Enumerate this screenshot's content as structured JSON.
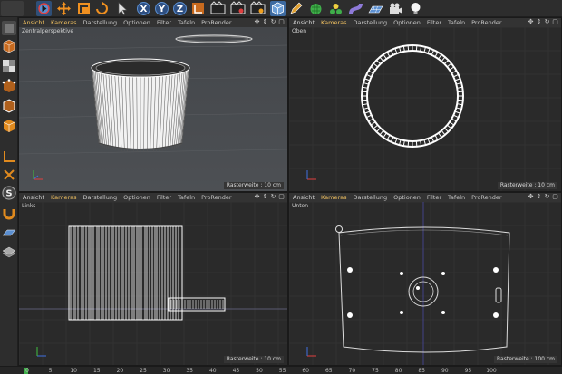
{
  "viewports": {
    "perspective": {
      "menus": [
        "Ansicht",
        "Kameras",
        "Darstellung",
        "Optionen",
        "Filter",
        "Tafeln",
        "ProRender"
      ],
      "label": "Zentralperspektive",
      "raster": "Rasterweite : 10 cm"
    },
    "top": {
      "menus": [
        "Ansicht",
        "Kameras",
        "Darstellung",
        "Optionen",
        "Filter",
        "Tafeln",
        "ProRender"
      ],
      "label": "Oben",
      "raster": "Rasterweite : 10 cm"
    },
    "left": {
      "menus": [
        "Ansicht",
        "Kameras",
        "Darstellung",
        "Optionen",
        "Filter",
        "Tafeln",
        "ProRender"
      ],
      "label": "Links",
      "raster": "Rasterweite : 10 cm"
    },
    "bottom": {
      "menus": [
        "Ansicht",
        "Kameras",
        "Darstellung",
        "Optionen",
        "Filter",
        "Tafeln",
        "ProRender"
      ],
      "label": "Unten",
      "raster": "Rasterweite : 100 cm"
    }
  },
  "timeline": {
    "ticks": [
      "0",
      "5",
      "10",
      "15",
      "20",
      "25",
      "30",
      "35",
      "40",
      "45",
      "50",
      "55",
      "60",
      "65",
      "70",
      "75",
      "80",
      "85",
      "90",
      "95",
      "100"
    ]
  },
  "colors": {
    "background": "#3a3a3a",
    "viewport_bg": "#2a2a2a",
    "perspective_bg": "#4a4d50",
    "accent_orange": "#e08a1e",
    "accent_blue": "#3a6ea8",
    "wire": "#ffffff"
  },
  "toolbar_icons": [
    "undo-icon",
    "move-icon",
    "scale-icon",
    "rotate-icon",
    "select-icon",
    "x-axis-icon",
    "y-axis-icon",
    "z-axis-icon",
    "coordinate-system-icon",
    "render-view-icon",
    "render-picture-icon",
    "render-settings-icon",
    "cube-icon",
    "pen-icon",
    "subdivision-icon",
    "array-icon",
    "deformer-icon",
    "floor-icon",
    "camera-icon",
    "light-icon"
  ]
}
